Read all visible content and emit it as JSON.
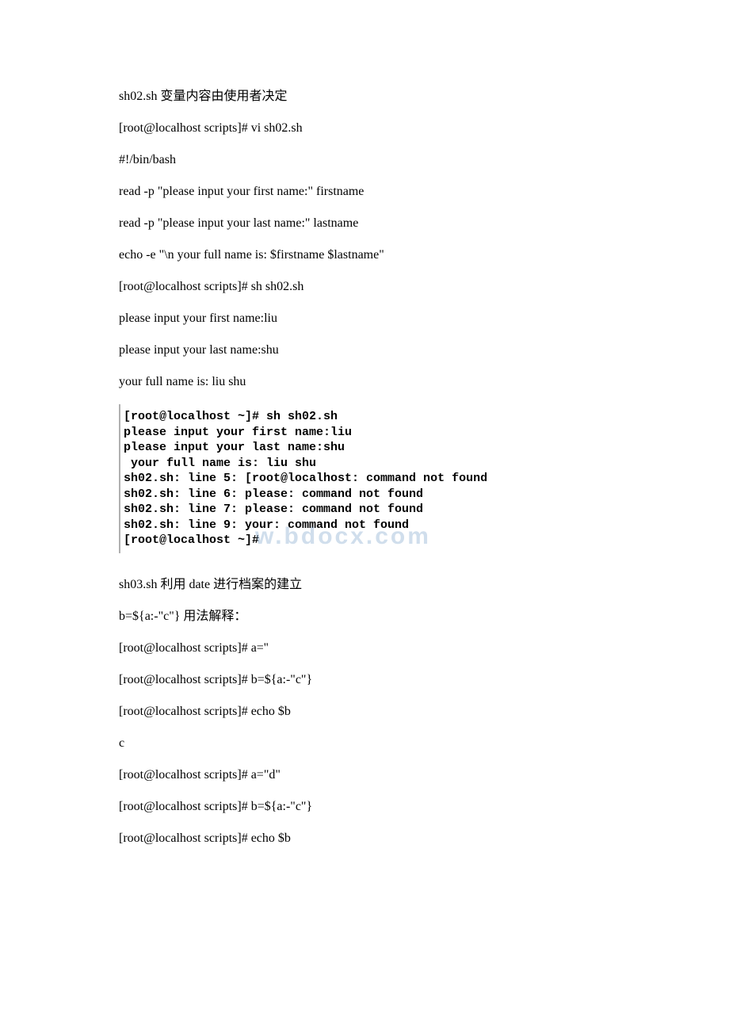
{
  "section1": {
    "title": "sh02.sh 变量内容由使用者决定",
    "lines": [
      "[root@localhost scripts]# vi sh02.sh",
      "#!/bin/bash",
      "read -p \"please input your first name:\" firstname",
      "read -p \"please input your last name:\" lastname",
      "echo -e \"\\n your full name is: $firstname $lastname\"",
      "[root@localhost scripts]# sh sh02.sh",
      "please input your first name:liu",
      "please input your last name:shu",
      "your full name is: liu shu"
    ]
  },
  "terminal": {
    "lines": [
      "[root@localhost ~]# sh sh02.sh",
      "please input your first name:liu",
      "please input your last name:shu",
      "",
      " your full name is: liu shu",
      "sh02.sh: line 5: [root@localhost: command not found",
      "sh02.sh: line 6: please: command not found",
      "sh02.sh: line 7: please: command not found",
      "sh02.sh: line 9: your: command not found",
      "[root@localhost ~]# "
    ],
    "watermark": "w.bdocx.com"
  },
  "section2": {
    "title": "sh03.sh 利用 date 进行档案的建立",
    "lines": [
      "b=${a:-\"c\"} 用法解释：",
      "[root@localhost scripts]# a=''",
      "[root@localhost scripts]# b=${a:-\"c\"}",
      "[root@localhost scripts]# echo $b",
      "c",
      "[root@localhost scripts]# a=\"d\"",
      "[root@localhost scripts]# b=${a:-\"c\"}",
      "[root@localhost scripts]# echo $b"
    ]
  }
}
